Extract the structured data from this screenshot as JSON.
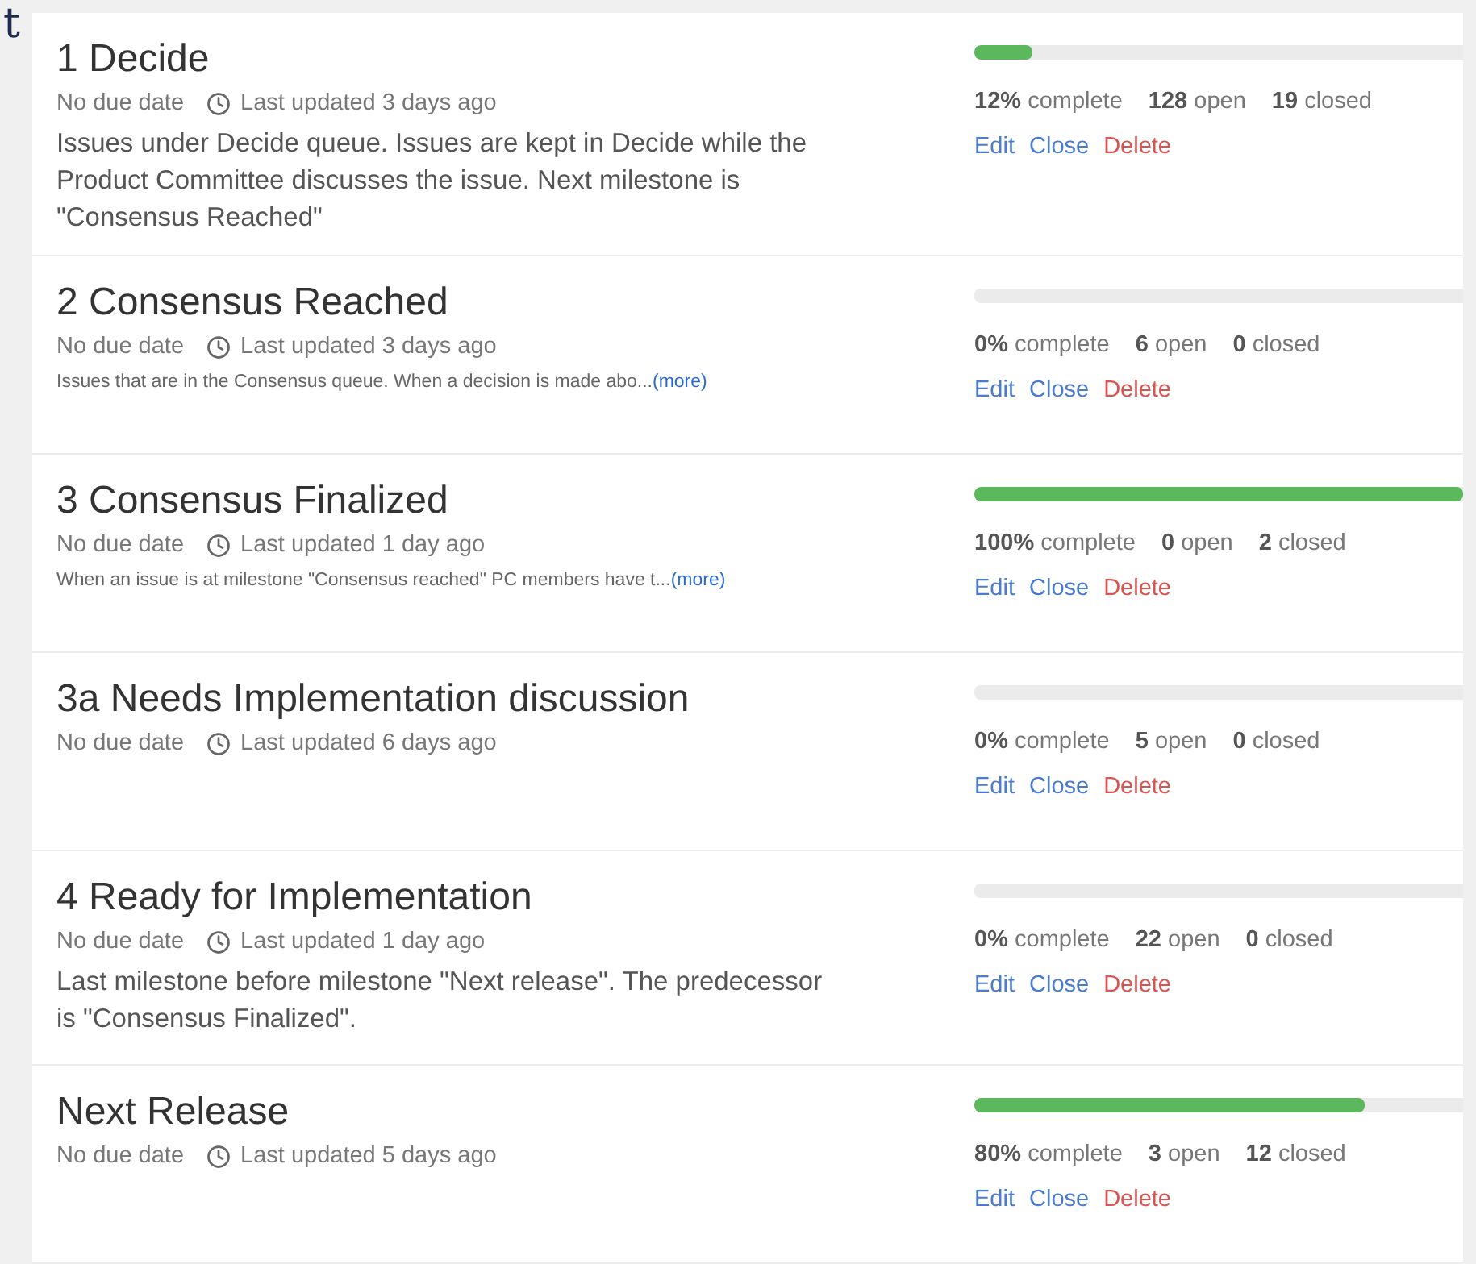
{
  "corner_fragment": "t",
  "milestones": [
    {
      "title": "1 Decide",
      "due": "No due date",
      "updated": "Last updated 3 days ago",
      "description": {
        "kind": "full",
        "text": "Issues under Decide queue. Issues are kept in Decide while the Product Committee discusses the issue. Next milestone is \"Consensus Reached\""
      },
      "level": 0.12,
      "percent": "12%",
      "percent_label": "complete",
      "open": "128",
      "open_label": "open",
      "closed": "19",
      "closed_label": "closed",
      "actions": [
        {
          "label": "Edit",
          "kind": "normal"
        },
        {
          "label": "Close",
          "kind": "normal"
        },
        {
          "label": "Delete",
          "kind": "danger"
        }
      ]
    },
    {
      "title": "2 Consensus Reached",
      "due": "No due date",
      "updated": "Last updated 3 days ago",
      "description": {
        "kind": "short",
        "text": "Issues that are in the Consensus queue. When a decision is made abo...",
        "more": "(more)"
      },
      "level": 0,
      "percent": "0%",
      "percent_label": "complete",
      "open": "6",
      "open_label": "open",
      "closed": "0",
      "closed_label": "closed",
      "actions": [
        {
          "label": "Edit",
          "kind": "normal"
        },
        {
          "label": "Close",
          "kind": "normal"
        },
        {
          "label": "Delete",
          "kind": "danger"
        }
      ]
    },
    {
      "title": "3 Consensus Finalized",
      "due": "No due date",
      "updated": "Last updated 1 day ago",
      "description": {
        "kind": "short",
        "text": "When an issue is at milestone \"Consensus reached\" PC members have t...",
        "more": "(more)"
      },
      "level": 1,
      "percent": "100%",
      "percent_label": "complete",
      "open": "0",
      "open_label": "open",
      "closed": "2",
      "closed_label": "closed",
      "actions": [
        {
          "label": "Edit",
          "kind": "normal"
        },
        {
          "label": "Close",
          "kind": "normal"
        },
        {
          "label": "Delete",
          "kind": "danger"
        }
      ]
    },
    {
      "title": "3a Needs Implementation discussion",
      "due": "No due date",
      "updated": "Last updated 6 days ago",
      "level": 0,
      "percent": "0%",
      "percent_label": "complete",
      "open": "5",
      "open_label": "open",
      "closed": "0",
      "closed_label": "closed",
      "actions": [
        {
          "label": "Edit",
          "kind": "normal"
        },
        {
          "label": "Close",
          "kind": "normal"
        },
        {
          "label": "Delete",
          "kind": "danger"
        }
      ]
    },
    {
      "title": "4 Ready for Implementation",
      "due": "No due date",
      "updated": "Last updated 1 day ago",
      "description": {
        "kind": "full",
        "text": "Last milestone before milestone \"Next release\". The predecessor is \"Consensus Finalized\"."
      },
      "level": 0,
      "percent": "0%",
      "percent_label": "complete",
      "open": "22",
      "open_label": "open",
      "closed": "0",
      "closed_label": "closed",
      "actions": [
        {
          "label": "Edit",
          "kind": "normal"
        },
        {
          "label": "Close",
          "kind": "normal"
        },
        {
          "label": "Delete",
          "kind": "danger"
        }
      ]
    },
    {
      "title": "Next Release",
      "due": "No due date",
      "updated": "Last updated 5 days ago",
      "level": 0.8,
      "percent": "80%",
      "percent_label": "complete",
      "open": "3",
      "open_label": "open",
      "closed": "12",
      "closed_label": "closed",
      "actions": [
        {
          "label": "Edit",
          "kind": "normal"
        },
        {
          "label": "Close",
          "kind": "normal"
        },
        {
          "label": "Delete",
          "kind": "danger"
        }
      ]
    }
  ]
}
